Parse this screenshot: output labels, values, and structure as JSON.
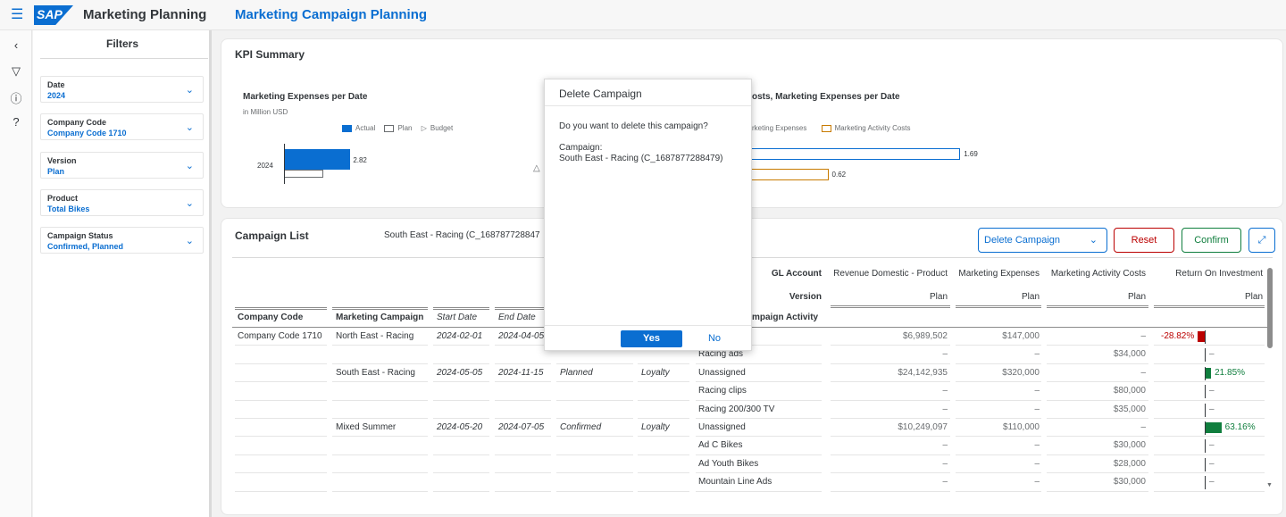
{
  "shell": {
    "app_title": "Marketing Planning",
    "page_title": "Marketing Campaign Planning",
    "logo_text": "SAP"
  },
  "sidebar_icons": [
    "collapse-icon",
    "filter-icon",
    "info-icon",
    "help-icon"
  ],
  "filters": {
    "title": "Filters",
    "items": [
      {
        "label": "Date",
        "value": "2024"
      },
      {
        "label": "Company Code",
        "value": "Company Code 1710"
      },
      {
        "label": "Version",
        "value": "Plan"
      },
      {
        "label": "Product",
        "value": "Total Bikes"
      },
      {
        "label": "Campaign Status",
        "value": "Confirmed, Planned"
      }
    ]
  },
  "kpi": {
    "title": "KPI Summary",
    "chart1": {
      "title": "Marketing Expenses per Date",
      "subtitle": "in Million USD",
      "legend": [
        "Actual",
        "Plan",
        "Budget"
      ],
      "category": "2024",
      "value_label": "2.82"
    },
    "chart2": {
      "title": "osts, Marketing Expenses per Date",
      "legend": [
        "rketing Expenses",
        "Marketing Activity Costs"
      ],
      "value_labels": [
        "1.69",
        "0.62"
      ]
    }
  },
  "chart_data": [
    {
      "type": "bar",
      "title": "Marketing Expenses per Date",
      "subtitle": "in Million USD",
      "categories": [
        "2024"
      ],
      "series": [
        {
          "name": "Actual",
          "values": [
            2.82
          ]
        }
      ]
    },
    {
      "type": "bar",
      "title": "osts, Marketing Expenses per Date",
      "categories": [
        "2024"
      ],
      "series": [
        {
          "name": "rketing Expenses",
          "values": [
            1.69
          ]
        },
        {
          "name": "Marketing Activity Costs",
          "values": [
            0.62
          ]
        }
      ]
    }
  ],
  "campaign_list": {
    "title": "Campaign List",
    "selected": "South East - Racing (C_168787728847",
    "dropdown_label": "Delete Campaign",
    "reset_label": "Reset",
    "confirm_label": "Confirm",
    "gl_account_label": "GL Account",
    "version_label": "Version",
    "measure_headers": [
      "Revenue Domestic - Product",
      "Marketing Expenses",
      "Marketing Activity Costs",
      "Return On Investment"
    ],
    "version_values": [
      "Plan",
      "Plan",
      "Plan",
      "Plan"
    ],
    "dim_headers": [
      "Company Code",
      "Marketing Campaign",
      "Start Date",
      "End Date",
      "",
      "",
      "mpaign Activity"
    ],
    "rows": [
      {
        "company": "Company Code 1710",
        "campaign": "North East - Racing",
        "start": "2024-02-01",
        "end": "2024-04-05",
        "status": "",
        "type": "",
        "activity": "",
        "rev": "$6,989,502",
        "mkt": "$147,000",
        "act": "–",
        "roi": "-28.82%"
      },
      {
        "company": "",
        "campaign": "",
        "start": "",
        "end": "",
        "status": "",
        "type": "",
        "activity": "Racing ads",
        "rev": "–",
        "mkt": "–",
        "act": "$34,000",
        "roi": "–"
      },
      {
        "company": "",
        "campaign": "South East - Racing",
        "start": "2024-05-05",
        "end": "2024-11-15",
        "status": "Planned",
        "type": "Loyalty",
        "activity": "Unassigned",
        "rev": "$24,142,935",
        "mkt": "$320,000",
        "act": "–",
        "roi": "21.85%"
      },
      {
        "company": "",
        "campaign": "",
        "start": "",
        "end": "",
        "status": "",
        "type": "",
        "activity": "Racing clips",
        "rev": "–",
        "mkt": "–",
        "act": "$80,000",
        "roi": "–"
      },
      {
        "company": "",
        "campaign": "",
        "start": "",
        "end": "",
        "status": "",
        "type": "",
        "activity": "Racing 200/300 TV",
        "rev": "–",
        "mkt": "–",
        "act": "$35,000",
        "roi": "–"
      },
      {
        "company": "",
        "campaign": "Mixed Summer",
        "start": "2024-05-20",
        "end": "2024-07-05",
        "status": "Confirmed",
        "type": "Loyalty",
        "activity": "Unassigned",
        "rev": "$10,249,097",
        "mkt": "$110,000",
        "act": "–",
        "roi": "63.16%"
      },
      {
        "company": "",
        "campaign": "",
        "start": "",
        "end": "",
        "status": "",
        "type": "",
        "activity": "Ad C Bikes",
        "rev": "–",
        "mkt": "–",
        "act": "$30,000",
        "roi": "–"
      },
      {
        "company": "",
        "campaign": "",
        "start": "",
        "end": "",
        "status": "",
        "type": "",
        "activity": "Ad Youth Bikes",
        "rev": "–",
        "mkt": "–",
        "act": "$28,000",
        "roi": "–"
      },
      {
        "company": "",
        "campaign": "",
        "start": "",
        "end": "",
        "status": "",
        "type": "",
        "activity": "Mountain Line Ads",
        "rev": "–",
        "mkt": "–",
        "act": "$30,000",
        "roi": "–"
      }
    ],
    "roi_values": [
      -28.82,
      null,
      21.85,
      null,
      null,
      63.16,
      null,
      null,
      null
    ]
  },
  "dialog": {
    "title": "Delete Campaign",
    "question": "Do you want to delete this campaign?",
    "campaign_label": "Campaign:",
    "campaign_value": "South East - Racing (C_1687877288479)",
    "yes_label": "Yes",
    "no_label": "No"
  },
  "colors": {
    "brand": "#0a6ed1",
    "negative": "#bb0000",
    "positive": "#107e3e",
    "activity": "#c87b00"
  }
}
